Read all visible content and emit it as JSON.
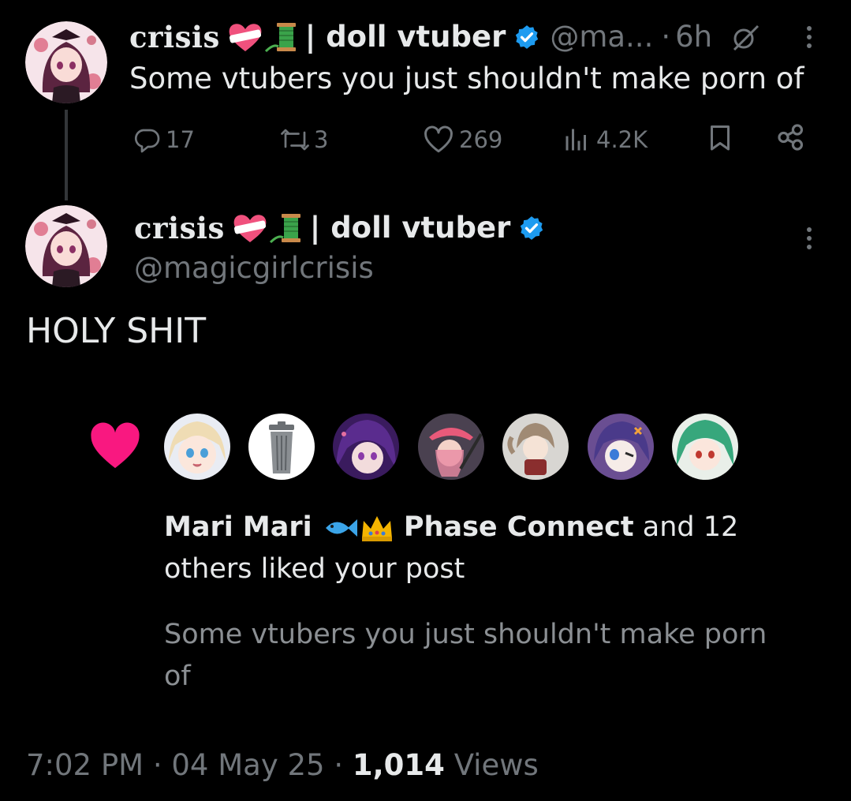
{
  "parent_tweet": {
    "author": {
      "display_name": "crisis",
      "name_suffix": "| doll vtuber",
      "handle": "@ma...",
      "verified": true
    },
    "separator": "·",
    "time": "6h",
    "text": "Some vtubers you just shouldn't make porn of",
    "actions": {
      "replies": "17",
      "reposts": "3",
      "likes": "269",
      "views": "4.2K"
    }
  },
  "main_tweet": {
    "author": {
      "display_name": "crisis",
      "name_suffix": "| doll vtuber",
      "handle": "@magicgirlcrisis",
      "verified": true
    },
    "text": "HOLY SHIT",
    "image": {
      "liked_by_names": [
        "Mari Mari",
        "Phase Connect"
      ],
      "liked_by_rest": "and 12",
      "liked_by_line2": "others liked your post",
      "quoted_text": "Some vtubers you just shouldn't make porn of"
    },
    "timestamp": {
      "time": "7:02 PM",
      "separator": "·",
      "date": "04 May 25",
      "views_count": "1,014",
      "views_label": "Views"
    }
  },
  "icons": [
    "reply-icon",
    "repost-icon",
    "like-icon",
    "views-icon",
    "bookmark-icon",
    "share-icon",
    "more-icon",
    "verified-badge-icon",
    "heart-icon"
  ],
  "colors": {
    "background": "#000000",
    "text": "#e7e9ea",
    "secondary": "#71767b",
    "verified": "#1d9bf0",
    "heart": "#f91880"
  }
}
